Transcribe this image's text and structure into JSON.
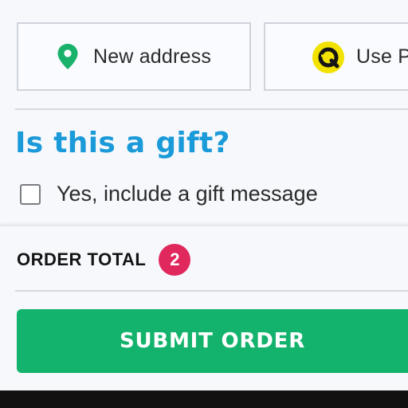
{
  "delivery_options": {
    "new_address_label": "New address",
    "pickup_label": "Use P",
    "new_address_icon": "map-pin-icon",
    "pickup_icon": "pickup-point-icon"
  },
  "gift": {
    "title": "Is this a gift?",
    "checkbox_label": "Yes, include a gift message",
    "checked": false
  },
  "order": {
    "total_label": "ORDER TOTAL",
    "item_count": "2"
  },
  "actions": {
    "submit_label": "SUBMIT ORDER"
  },
  "colors": {
    "accent_blue": "#1a9ad8",
    "submit_green": "#14b36d",
    "badge_pink": "#e0285d",
    "pin_green": "#19b26b",
    "pickup_yellow": "#f2e200"
  }
}
